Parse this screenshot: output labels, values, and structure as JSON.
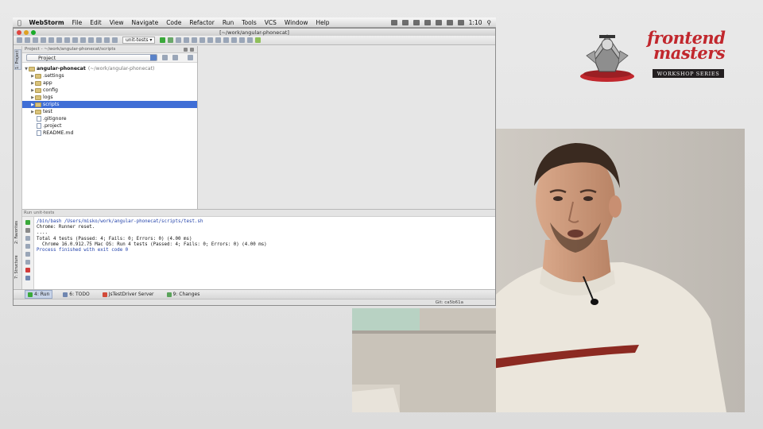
{
  "menubar": {
    "app_name": "WebStorm",
    "items": [
      "File",
      "Edit",
      "View",
      "Navigate",
      "Code",
      "Refactor",
      "Run",
      "Tools",
      "VCS",
      "Window",
      "Help"
    ],
    "clock": "1:10"
  },
  "window": {
    "title": "[~/work/angular-phonecat]",
    "run_config": "unit-tests"
  },
  "project_panel": {
    "header": "Project - ~/work/angular-phonecat/scripts",
    "view_mode": "Project",
    "root": {
      "name": "angular-phonecat",
      "path": "(~/work/angular-phonecat)"
    },
    "folders": [
      ".settings",
      "app",
      "config",
      "logs",
      "scripts",
      "test"
    ],
    "selected": "scripts",
    "files": [
      ".gitignore",
      ".project",
      "README.md"
    ]
  },
  "side_tabs": {
    "project": "1: Project",
    "favorites": "2: Favorites",
    "structure": "7: Structure"
  },
  "run_panel": {
    "header": "Run  unit-tests",
    "console_lines": [
      "/bin/bash /Users/misko/work/angular-phonecat/scripts/test.sh",
      "Chrome: Runner reset.",
      "....",
      "Total 4 tests (Passed: 4; Fails: 0; Errors: 0) (4.00 ms)",
      "  Chrome 16.0.912.75 Mac OS: Run 4 tests (Passed: 4; Fails: 0; Errors: 0) (4.00 ms)",
      "",
      "Process finished with exit code 0"
    ]
  },
  "bottom_tabs": [
    {
      "label": "4: Run",
      "active": true
    },
    {
      "label": "6: TODO",
      "active": false
    },
    {
      "label": "JsTestDriver Server",
      "active": false
    },
    {
      "label": "9: Changes",
      "active": false
    }
  ],
  "status_bar": {
    "git": "Git: ca5b61a"
  },
  "logo": {
    "line1": "frontend",
    "line2": "masters",
    "badge": "WORKSHOP SERIES"
  },
  "colors": {
    "selection": "#3f6ed6",
    "logo_red": "#c1272d",
    "console_blue": "#1f3fa8",
    "traffic_close": "#e0443e",
    "traffic_min": "#dea123",
    "traffic_max": "#1aab29"
  }
}
